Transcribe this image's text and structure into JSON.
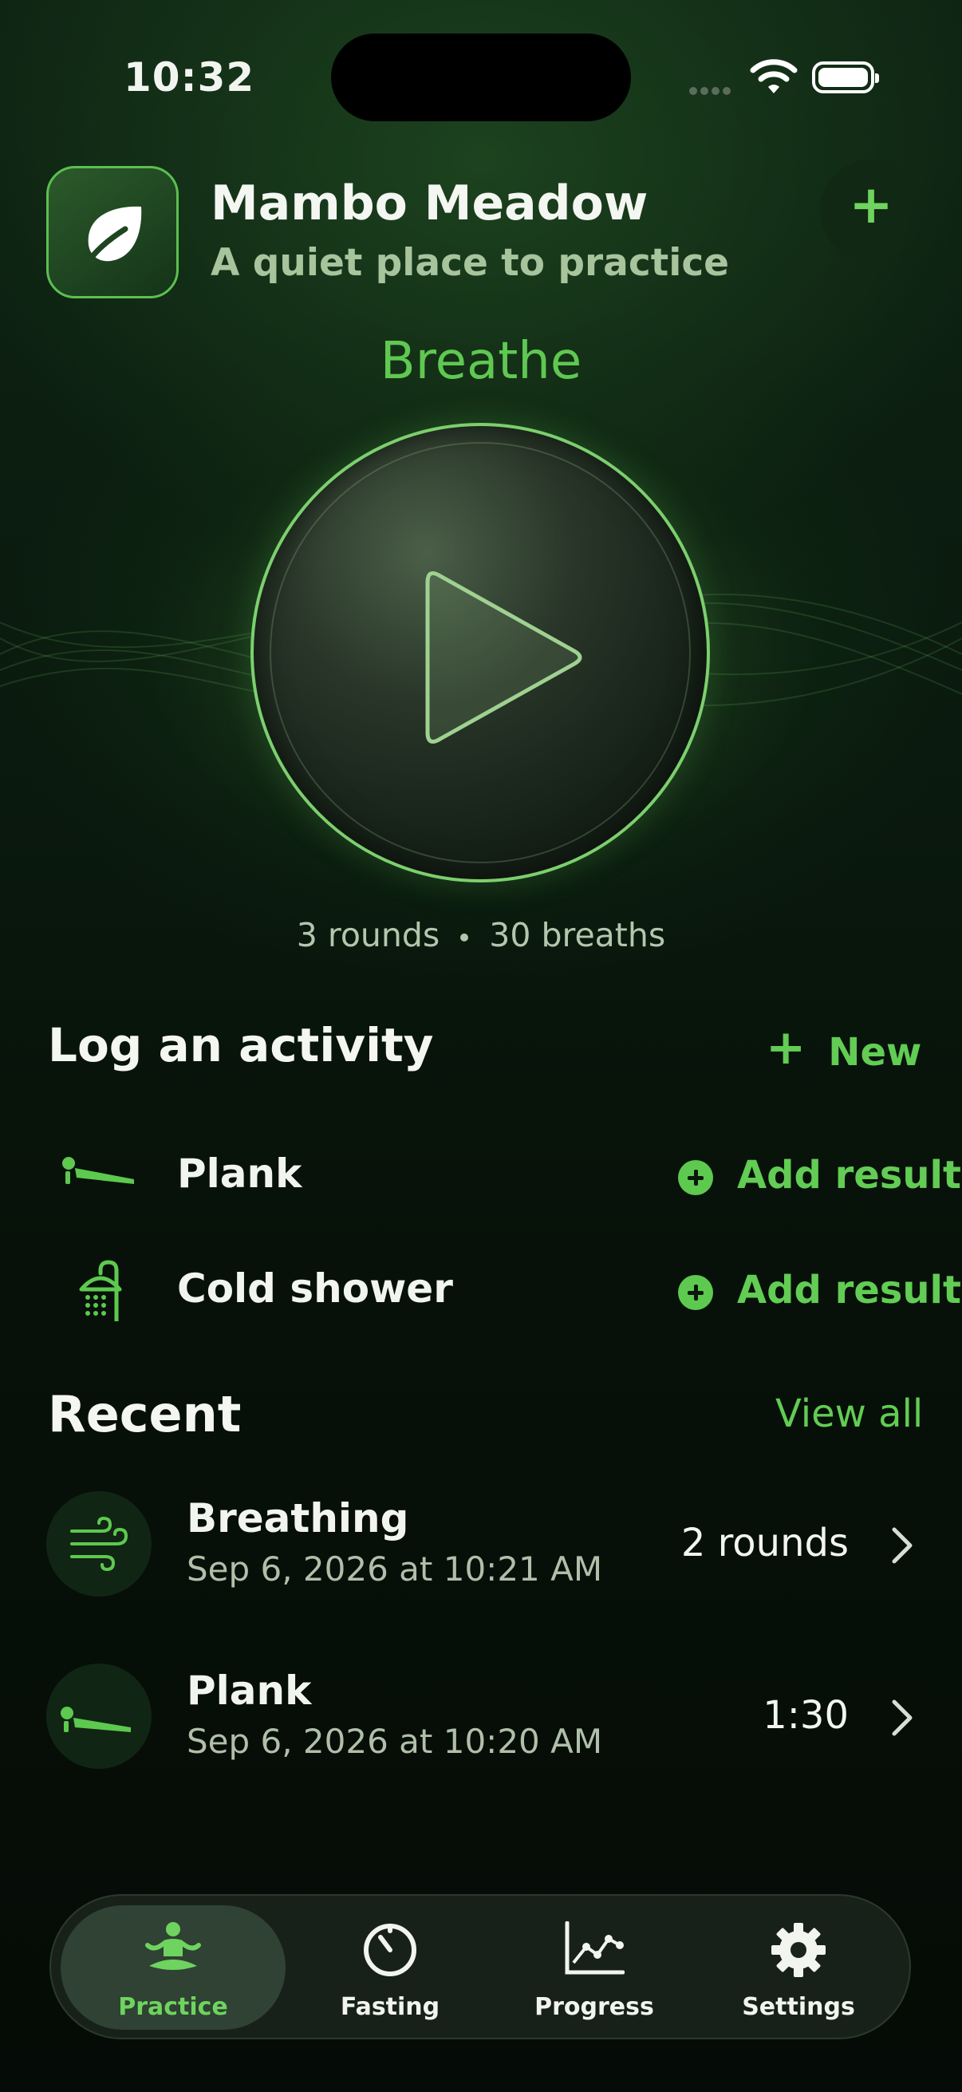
{
  "status_bar": {
    "time": "10:32"
  },
  "header": {
    "app_name": "Mambo Meadow",
    "subtitle": "A quiet place to practice",
    "add_icon": "plus-icon"
  },
  "breathe": {
    "title": "Breathe",
    "play_icon": "play-icon",
    "rounds": "3 rounds",
    "breaths": "30 breaths"
  },
  "log_activity": {
    "title": "Log an activity",
    "new_label": "New",
    "items": [
      {
        "label": "Plank",
        "icon": "plank-icon",
        "action": "Add result"
      },
      {
        "label": "Cold shower",
        "icon": "shower-icon",
        "action": "Add result"
      }
    ]
  },
  "recent": {
    "title": "Recent",
    "view_all": "View all",
    "items": [
      {
        "title": "Breathing",
        "date": "Sep 6, 2026 at 10:21 AM",
        "value": "2 rounds",
        "icon": "wind-icon"
      },
      {
        "title": "Plank",
        "date": "Sep 6, 2026 at 10:20 AM",
        "value": "1:30",
        "icon": "plank-icon"
      }
    ]
  },
  "tabs": [
    {
      "label": "Practice",
      "icon": "meditation-icon",
      "active": true
    },
    {
      "label": "Fasting",
      "icon": "timer-icon",
      "active": false
    },
    {
      "label": "Progress",
      "icon": "chart-icon",
      "active": false
    },
    {
      "label": "Settings",
      "icon": "gear-icon",
      "active": false
    }
  ],
  "colors": {
    "accent": "#5fc851",
    "background": "#07110a",
    "secondary_text": "#b0bfaa"
  }
}
